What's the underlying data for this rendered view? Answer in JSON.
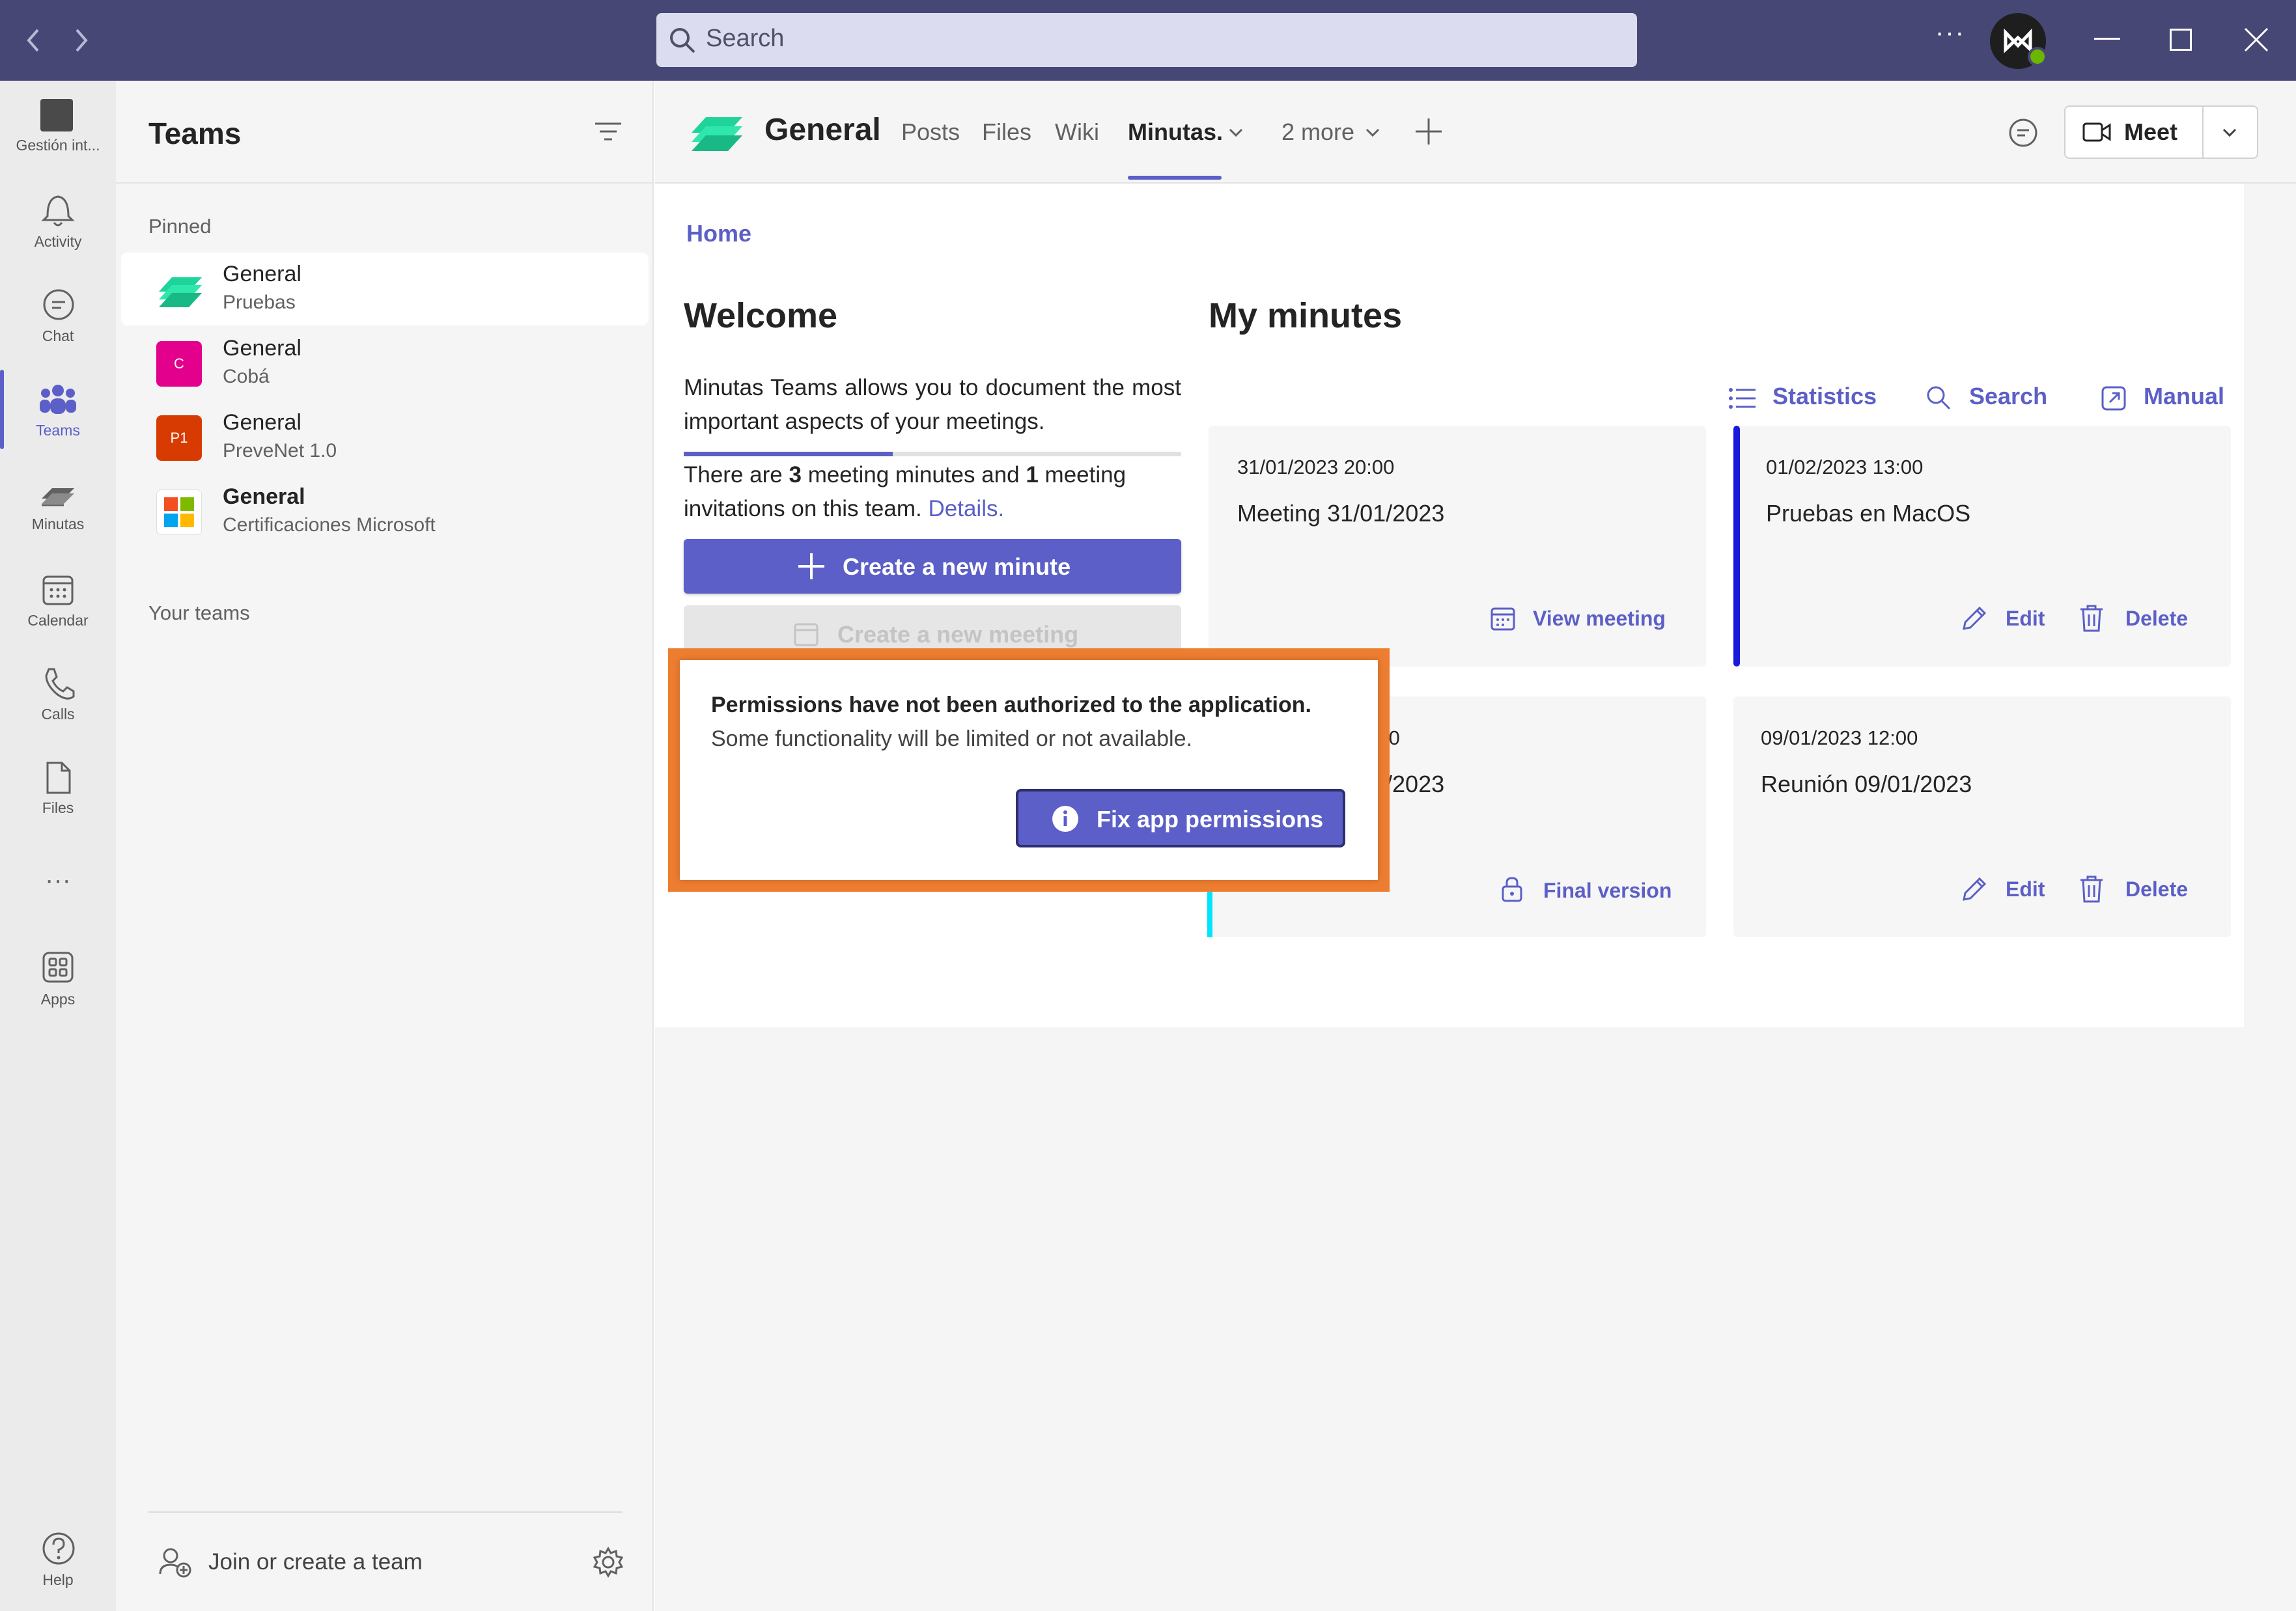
{
  "titlebar": {
    "search_placeholder": "Search",
    "more_label": "···"
  },
  "rail": {
    "org_label": "Gestión int...",
    "items": [
      {
        "label": "Activity",
        "icon": "bell-icon"
      },
      {
        "label": "Chat",
        "icon": "chat-icon"
      },
      {
        "label": "Teams",
        "icon": "teams-icon",
        "active": true
      },
      {
        "label": "Minutas",
        "icon": "minutas-icon"
      },
      {
        "label": "Calendar",
        "icon": "calendar-icon"
      },
      {
        "label": "Calls",
        "icon": "phone-icon"
      },
      {
        "label": "Files",
        "icon": "file-icon"
      },
      {
        "label": "Apps",
        "icon": "apps-icon"
      },
      {
        "label": "Help",
        "icon": "help-icon"
      }
    ],
    "more_label": "···"
  },
  "panel": {
    "title": "Teams",
    "pinned_label": "Pinned",
    "your_teams_label": "Your teams",
    "join_label": "Join or create a team",
    "teams": [
      {
        "name": "General",
        "sub": "Pruebas",
        "avatar_text": "",
        "color": "#2bd69a"
      },
      {
        "name": "General",
        "sub": "Cobá",
        "avatar_text": "C",
        "color": "#e3008c"
      },
      {
        "name": "General",
        "sub": "PreveNet 1.0",
        "avatar_text": "P1",
        "color": "#d83b01"
      },
      {
        "name": "General",
        "sub": "Certificaciones Microsoft",
        "avatar_text": "",
        "color": "#ffffff"
      }
    ]
  },
  "channel": {
    "name": "General",
    "tabs": [
      "Posts",
      "Files",
      "Wiki",
      "Minutas.",
      "2 more"
    ],
    "meet_label": "Meet"
  },
  "app": {
    "breadcrumb": "Home",
    "welcome_title": "Welcome",
    "welcome_text": "Minutas Teams allows you to document the most important aspects of your meetings.",
    "count_prefix": "There are",
    "minutes_count": "3",
    "count_middle": "meeting minutes and",
    "invites_count": "1",
    "count_suffix": "meeting invitations on this team.",
    "details_link": "Details.",
    "create_minute_label": "Create a new minute",
    "create_meeting_label": "Create a new meeting",
    "my_minutes_title": "My minutes",
    "statistics_label": "Statistics",
    "search_label": "Search",
    "manual_label": "Manual",
    "cards": [
      {
        "date": "31/01/2023 20:00",
        "title": "Meeting 31/01/2023",
        "actions": [
          "View meeting"
        ]
      },
      {
        "date": "01/02/2023 13:00",
        "title": "Pruebas en MacOS",
        "actions": [
          "Edit",
          "Delete"
        ]
      },
      {
        "date": ":0",
        "title": "1/2023",
        "actions": [
          "Final version"
        ]
      },
      {
        "date": "09/01/2023 12:00",
        "title": "Reunión 09/01/2023",
        "actions": [
          "Edit",
          "Delete"
        ]
      }
    ]
  },
  "popup": {
    "title": "Permissions have not been authorized to the application.",
    "body": "Some functionality will be limited or not available.",
    "button_label": "Fix app permissions",
    "accent": "#ed7d31"
  },
  "colors": {
    "brand": "#5b5fc7",
    "titlebar": "#464775"
  }
}
